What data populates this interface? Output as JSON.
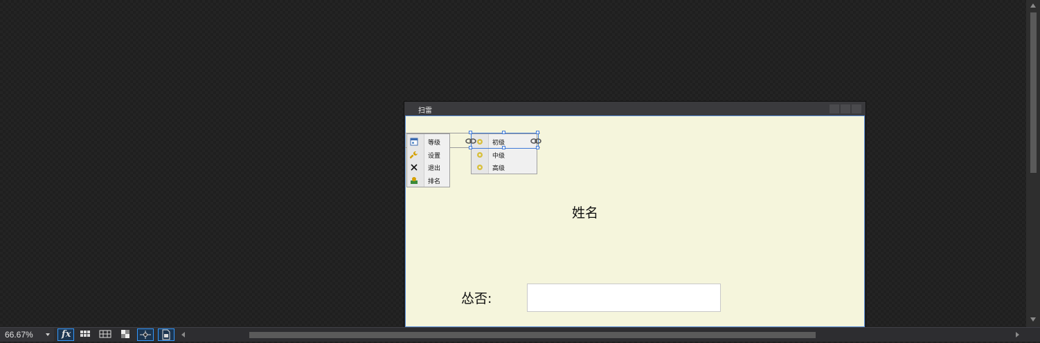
{
  "form": {
    "title": "扫雷",
    "name_label": "姓名",
    "field_label": "怂否:",
    "field_value": ""
  },
  "main_menu": {
    "items": [
      {
        "label": "等级",
        "icon": "window-icon"
      },
      {
        "label": "设置",
        "icon": "wrench-icon"
      },
      {
        "label": "退出",
        "icon": "close-x-icon"
      },
      {
        "label": "排名",
        "icon": "ranking-icon"
      }
    ]
  },
  "submenu": {
    "items": [
      {
        "label": "初级",
        "icon": "gear-icon"
      },
      {
        "label": "中级",
        "icon": "gear-icon"
      },
      {
        "label": "高级",
        "icon": "gear-icon"
      }
    ]
  },
  "statusbar": {
    "zoom": "66.67%",
    "fx_label": "fx"
  },
  "colors": {
    "form_background": "#f5f5dc",
    "selection": "#3c78d8",
    "canvas_background": "#1f1f1f"
  }
}
